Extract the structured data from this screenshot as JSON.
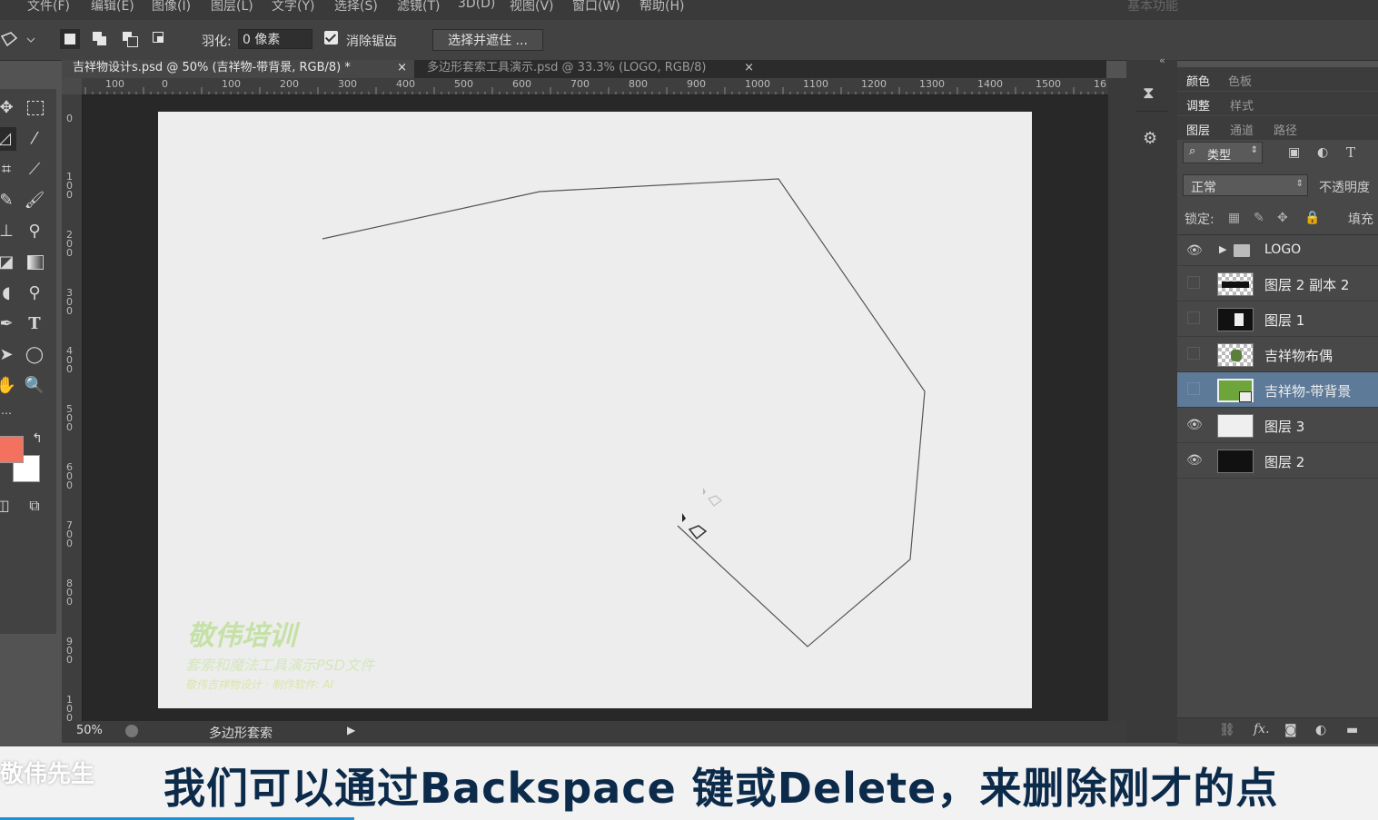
{
  "menu": [
    "文件(F)",
    "编辑(E)",
    "图像(I)",
    "图层(L)",
    "文字(Y)",
    "选择(S)",
    "滤镜(T)",
    "3D(D)",
    "视图(V)",
    "窗口(W)",
    "帮助(H)"
  ],
  "menu_right": "基本功能",
  "options": {
    "feather_label": "羽化:",
    "feather_value": "0 像素",
    "antialias_label": "消除锯齿",
    "antialias_checked": true,
    "refine_button": "选择并遮住 ..."
  },
  "tabs": [
    {
      "label": "吉祥物设计s.psd @ 50% (吉祥物-带背景, RGB/8) *",
      "active": true
    },
    {
      "label": "多边形套索工具演示.psd @ 33.3% (LOGO, RGB/8)",
      "active": false
    }
  ],
  "ruler_top": [
    "100",
    "0",
    "100",
    "200",
    "300",
    "400",
    "500",
    "600",
    "700",
    "800",
    "900",
    "1000",
    "1100",
    "1200",
    "1300",
    "1400",
    "1500",
    "16"
  ],
  "ruler_left": [
    "0",
    "100",
    "200",
    "300",
    "400",
    "500",
    "600",
    "700",
    "800",
    "900",
    "100"
  ],
  "status": {
    "zoom": "50%",
    "tool_name": "多边形套索"
  },
  "colors": {
    "foreground": "#f2715f",
    "background": "#ffffff",
    "selected_layer": "#5d7a98"
  },
  "canvas_watermark": {
    "title": "敬伟培训",
    "line1": "套索和魔法工具演示PSD文件",
    "line2": "敬伟吉祥物设计 · 制作软件: AI"
  },
  "panel": {
    "tabs_row1": [
      "颜色",
      "色板"
    ],
    "tabs_row2": [
      "调整",
      "样式"
    ],
    "tabs_row3": [
      "图层",
      "通道",
      "路径"
    ],
    "filter_kind": "类型",
    "blend_mode": "正常",
    "opacity_label": "不透明度",
    "lock_label": "锁定:",
    "fill_label": "填充"
  },
  "layers": [
    {
      "name": "LOGO",
      "visible": true,
      "type": "group"
    },
    {
      "name": "图层 2 副本 2",
      "visible": false,
      "type": "checker-bar"
    },
    {
      "name": "图层 1",
      "visible": false,
      "type": "black-white"
    },
    {
      "name": "吉祥物布偶",
      "visible": false,
      "type": "checker-figure"
    },
    {
      "name": "吉祥物-带背景",
      "visible": false,
      "type": "green",
      "selected": true
    },
    {
      "name": "图层 3",
      "visible": true,
      "type": "light"
    },
    {
      "name": "图层 2",
      "visible": true,
      "type": "black"
    }
  ],
  "subtitle": "我们可以通过Backspace 键或Delete，来删除刚才的点",
  "subtitle_watermark": "敬伟先生"
}
